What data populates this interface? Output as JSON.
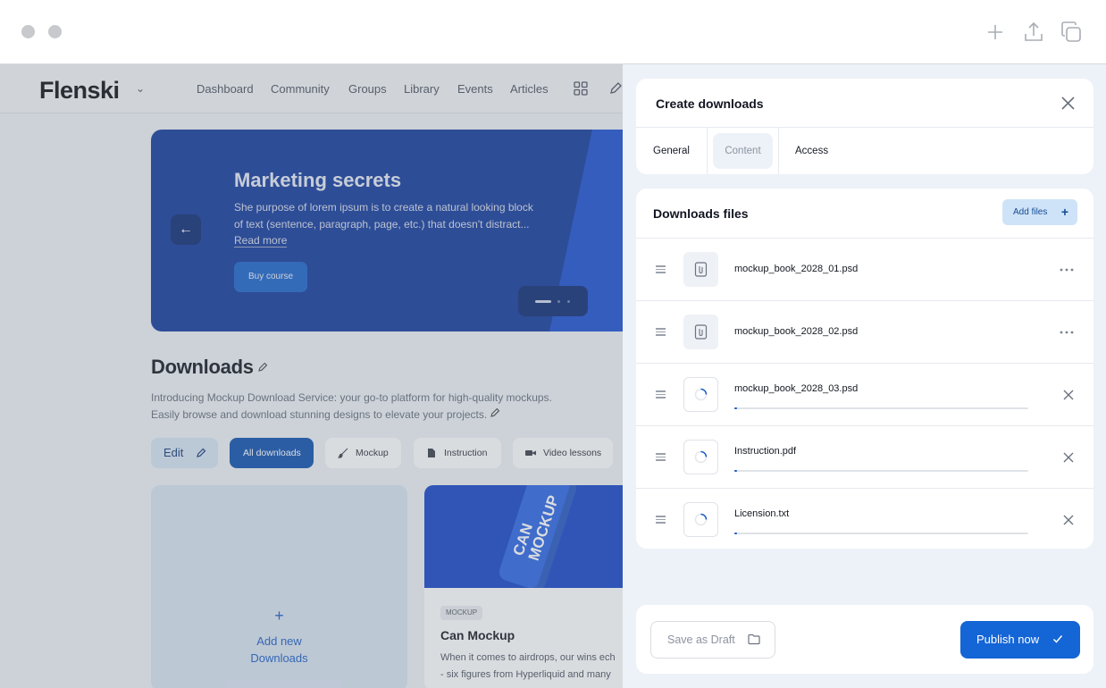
{
  "window": {
    "toolbar_icons": [
      "plus-icon",
      "share-icon",
      "copy-icon"
    ]
  },
  "app": {
    "logo": "Flenski",
    "nav": [
      "Dashboard",
      "Community",
      "Groups",
      "Library",
      "Events",
      "Articles"
    ],
    "hero": {
      "title": "Marketing secrets",
      "description": "She purpose of lorem ipsum is to create a natural looking block of text (sentence, paragraph, page, etc.) that doesn't distract...",
      "read_more": "Read more",
      "button": "Buy course"
    },
    "downloads": {
      "title": "Downloads",
      "description": "Introducing Mockup Download Service: your go-to platform for high-quality mockups. Easily browse and download stunning designs to elevate your projects."
    },
    "filters": {
      "edit": "Edit",
      "all": "All downloads",
      "mockup": "Mockup",
      "instruction": "Instruction",
      "video": "Video lessons"
    },
    "add_card": {
      "plus": "+",
      "label_line1": "Add new",
      "label_line2": "Downloads"
    },
    "product_card": {
      "badge": "MOCKUP",
      "title": "Can Mockup",
      "desc_line1": "When it comes to airdrops, our wins ech",
      "desc_line2": "- six figures from Hyperliquid and many",
      "image_text_line1": "CAN",
      "image_text_line2": "MOCKUP"
    }
  },
  "panel": {
    "title": "Create downloads",
    "tabs": {
      "general": "General",
      "content": "Content",
      "access": "Access"
    },
    "files_title": "Downloads files",
    "add_files": "Add files",
    "add_files_plus": "+",
    "files": [
      {
        "name": "mockup_book_2028_01.psd",
        "status": "done"
      },
      {
        "name": "mockup_book_2028_02.psd",
        "status": "done"
      },
      {
        "name": "mockup_book_2028_03.psd",
        "status": "uploading",
        "progress": 0.01
      },
      {
        "name": "Instruction.pdf",
        "status": "uploading",
        "progress": 0.01
      },
      {
        "name": "Licension.txt",
        "status": "uploading",
        "progress": 0.01
      }
    ],
    "footer": {
      "draft": "Save as Draft",
      "publish": "Publish now"
    }
  },
  "colors": {
    "accent": "#1465d6",
    "hero_bg": "#123a9c",
    "panel_bg": "#edf2f8"
  }
}
